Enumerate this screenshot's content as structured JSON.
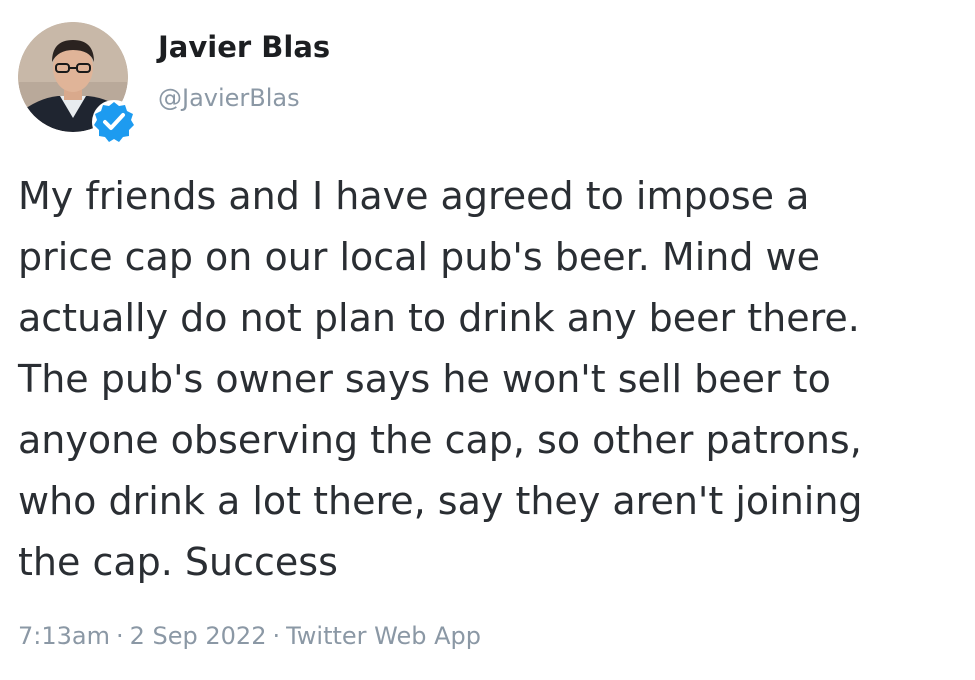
{
  "tweet": {
    "author": {
      "name": "Javier Blas",
      "handle": "@JavierBlas",
      "verified": true
    },
    "text": "My friends and I have agreed to impose a\nprice cap on our local pub's beer. Mind we\nactually do not plan to drink any beer there.\nThe pub's owner says he won't sell beer to\nanyone observing the cap, so other patrons,\nwho drink a lot there, say they aren't joining\nthe cap. Success",
    "time": "7:13am",
    "separator": "·",
    "date": "2 Sep 2022",
    "source": "Twitter Web App"
  },
  "icons": {
    "avatar": "avatar-photo",
    "verified": "verified-badge-icon"
  },
  "colors": {
    "verified_blue": "#1d9bf0",
    "meta_gray": "#8b98a5",
    "text": "#2a2e33"
  }
}
